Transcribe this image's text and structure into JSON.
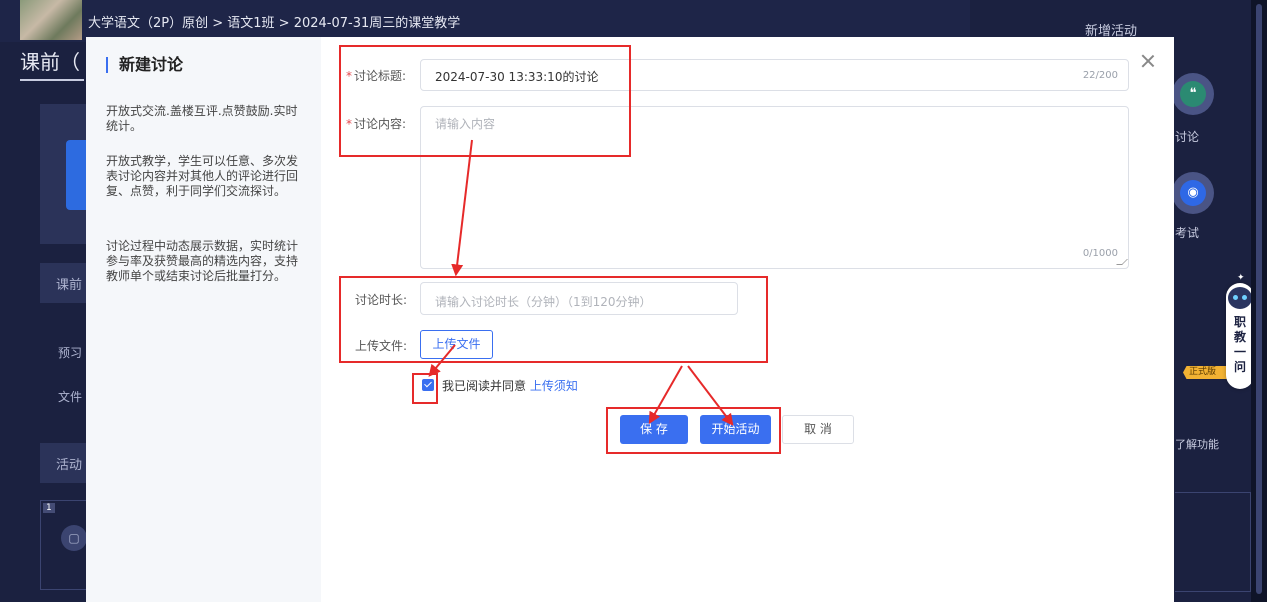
{
  "app": {
    "breadcrumb": "大学语文（2P）原创 > 语文1班 > 2024-07-31周三的课堂教学",
    "right_title": "新增活动",
    "left_title": "课前（",
    "left_buttons": [
      "课前",
      "活动"
    ],
    "left_items": [
      "预习",
      "文件"
    ],
    "left_panel_number": "1",
    "right_tools": [
      {
        "label": "讨论",
        "icon": "discussion-icon"
      },
      {
        "label": "考试",
        "icon": "exam-icon"
      }
    ],
    "right_func_text": "了解功能",
    "assistant": {
      "text": "职教一问",
      "badge": "正式版"
    }
  },
  "modal": {
    "title": "新建讨论",
    "desc": [
      "开放式交流.盖楼互评.点赞鼓励.实时统计。",
      "开放式教学，学生可以任意、多次发表讨论内容并对其他人的评论进行回复、点赞，利于同学们交流探讨。",
      "讨论过程中动态展示数据，实时统计参与率及获赞最高的精选内容，支持教师单个或结束讨论后批量打分。"
    ],
    "form": {
      "title_label": "讨论标题:",
      "title_value": "2024-07-30 13:33:10的讨论",
      "title_count": "22/200",
      "content_label": "讨论内容:",
      "content_placeholder": "请输入内容",
      "content_count": "0/1000",
      "duration_label": "讨论时长:",
      "duration_placeholder": "请输入讨论时长（分钟）（1到120分钟）",
      "upload_label": "上传文件:",
      "upload_button": "上传文件",
      "agree_text": "我已阅读并同意",
      "agree_link": "上传须知"
    },
    "buttons": {
      "save": "保 存",
      "start": "开始活动",
      "cancel": "取 消"
    }
  },
  "colors": {
    "accent": "#3a6ff0",
    "annotation": "#e62a2a",
    "background": "#1b2140"
  }
}
